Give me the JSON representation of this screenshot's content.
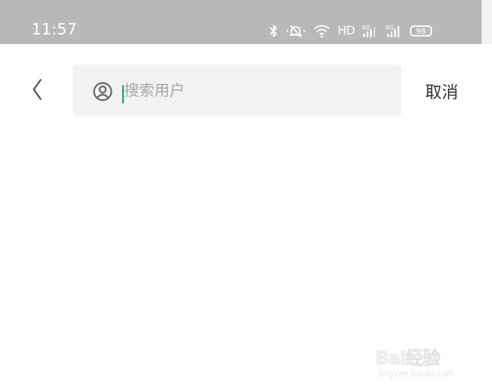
{
  "status_bar": {
    "time": "11:57",
    "network_label": "HD",
    "battery_level": "98",
    "icons": [
      "bluetooth-icon",
      "mute-icon",
      "wifi-icon",
      "hd-icon",
      "signal-4g-icon",
      "signal-4g-icon",
      "battery-icon"
    ]
  },
  "search": {
    "placeholder": "搜索用户",
    "value": "",
    "cancel_label": "取消",
    "back_icon": "chevron-left-icon",
    "user_icon": "user-circle-icon"
  },
  "watermark": {
    "brand": "Bai经验",
    "url": "jingyan.baidu.com"
  },
  "colors": {
    "status_bar_bg": "#b8b8b8",
    "search_box_bg": "#f2f2f2",
    "caret": "#4aa889",
    "text": "#333333",
    "placeholder": "#a5a5a5"
  }
}
